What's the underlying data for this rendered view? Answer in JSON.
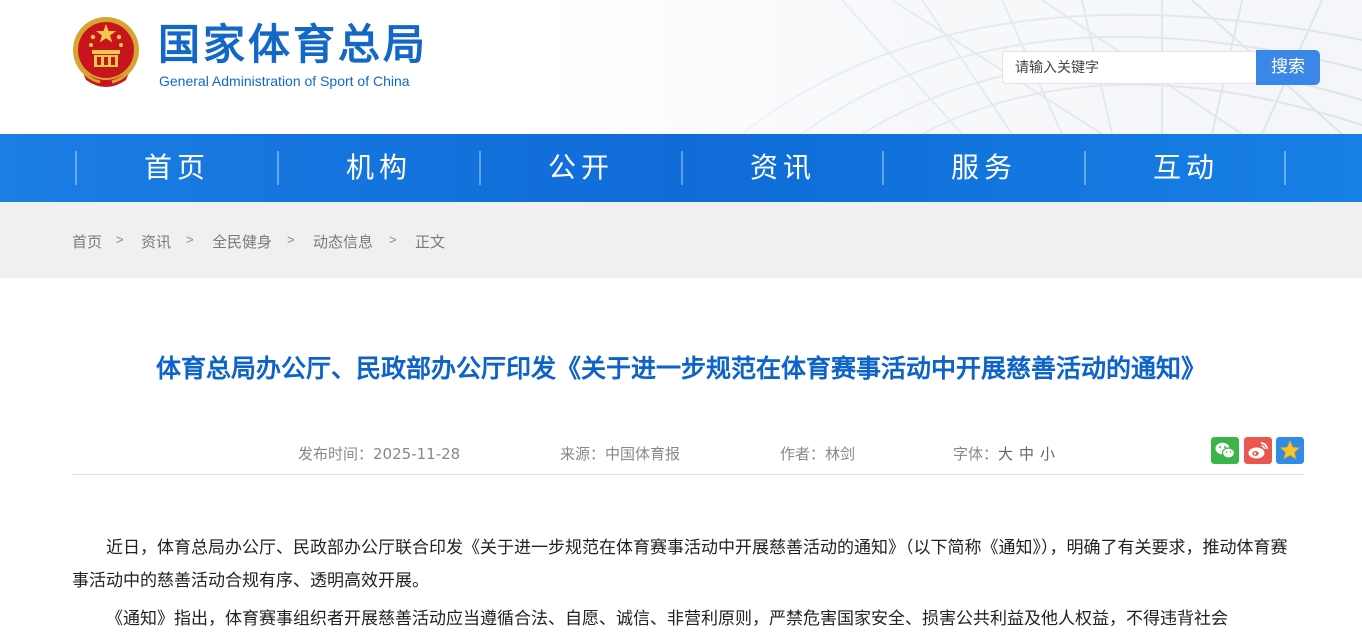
{
  "header": {
    "site_title": "国家体育总局",
    "site_subtitle": "General Administration of Sport of China",
    "search_placeholder": "请输入关键字",
    "search_button": "搜索"
  },
  "nav": {
    "items": [
      {
        "label": "首页"
      },
      {
        "label": "机构"
      },
      {
        "label": "公开"
      },
      {
        "label": "资讯"
      },
      {
        "label": "服务"
      },
      {
        "label": "互动"
      }
    ]
  },
  "breadcrumb": {
    "items": [
      "首页",
      "资讯",
      "全民健身",
      "动态信息",
      "正文"
    ],
    "separator": ">"
  },
  "article": {
    "title": "体育总局办公厅、民政部办公厅印发《关于进一步规范在体育赛事活动中开展慈善活动的通知》",
    "meta": {
      "date_label": "发布时间：",
      "date_value": "2025-11-28",
      "source_label": "来源：",
      "source_value": "中国体育报",
      "author_label": "作者：",
      "author_value": "林剑",
      "font_label": "字体：",
      "font_options": [
        "大",
        "中",
        "小"
      ]
    },
    "share_icons": [
      "wechat-icon",
      "weibo-icon",
      "favorite-star-icon"
    ],
    "paragraphs": [
      "近日，体育总局办公厅、民政部办公厅联合印发《关于进一步规范在体育赛事活动中开展慈善活动的通知》（以下简称《通知》），明确了有关要求，推动体育赛事活动中的慈善活动合规有序、透明高效开展。",
      "《通知》指出，体育赛事组织者开展慈善活动应当遵循合法、自愿、诚信、非营利原则，严禁危害国家安全、损害公共利益及他人权益，不得违背社会"
    ]
  },
  "colors": {
    "brand_blue": "#1368c7",
    "nav_blue": "#0f6bd8",
    "search_button": "#3b87e8",
    "breadcrumb_bg": "#f0f0f0"
  }
}
